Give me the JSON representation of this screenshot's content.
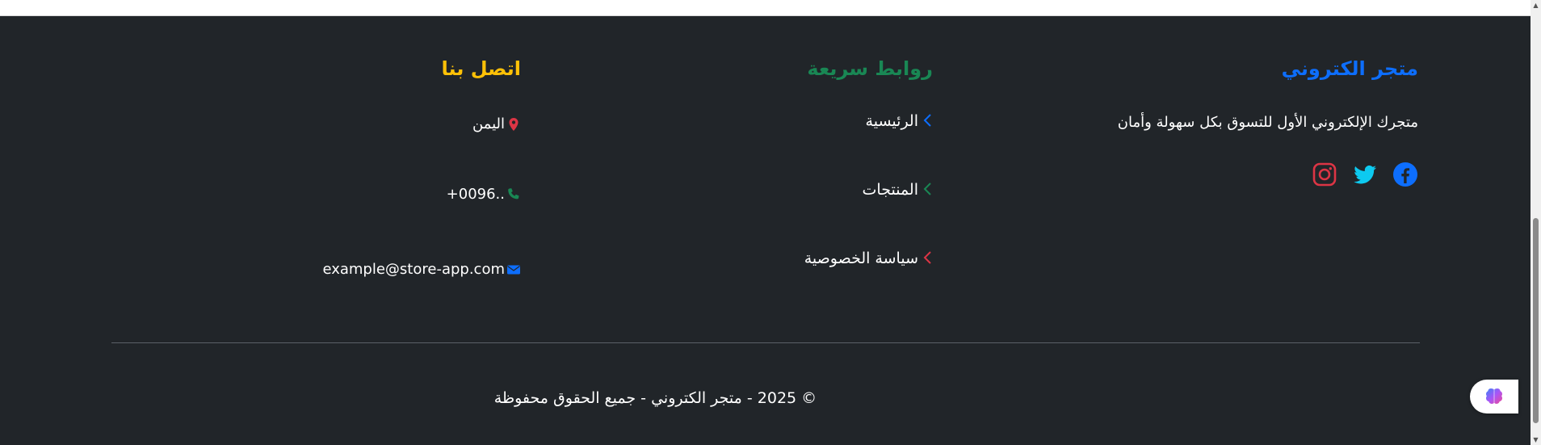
{
  "brand": {
    "title": "متجر الكتروني",
    "description": "متجرك الإلكتروني الأول للتسوق بكل سهولة وأمان",
    "social": [
      {
        "icon": "facebook-icon",
        "color": "#0d6efd"
      },
      {
        "icon": "twitter-icon",
        "color": "#0dcaf0"
      },
      {
        "icon": "instagram-icon",
        "color": "#dc3545"
      }
    ]
  },
  "quick_links": {
    "title": "روابط سريعة",
    "items": [
      {
        "label": "الرئيسية",
        "chevron_color": "#0d6efd"
      },
      {
        "label": "المنتجات",
        "chevron_color": "#198754"
      },
      {
        "label": "سياسة الخصوصية",
        "chevron_color": "#dc3545"
      }
    ]
  },
  "contact": {
    "title": "اتصل بنا",
    "location": {
      "icon": "location-pin-icon",
      "text": "اليمن",
      "color": "#dc3545"
    },
    "phone": {
      "icon": "phone-icon",
      "text": "+0096..",
      "color": "#198754"
    },
    "email": {
      "icon": "envelope-icon",
      "text": "example@store-app.com",
      "color": "#0d6efd"
    }
  },
  "footer": {
    "copyright": "© 2025 - متجر الكتروني - جميع الحقوق محفوظة"
  },
  "colors": {
    "background": "#212529",
    "brand_blue": "#0d6efd",
    "success_green": "#198754",
    "warning_yellow": "#ffc107",
    "danger_red": "#dc3545"
  }
}
